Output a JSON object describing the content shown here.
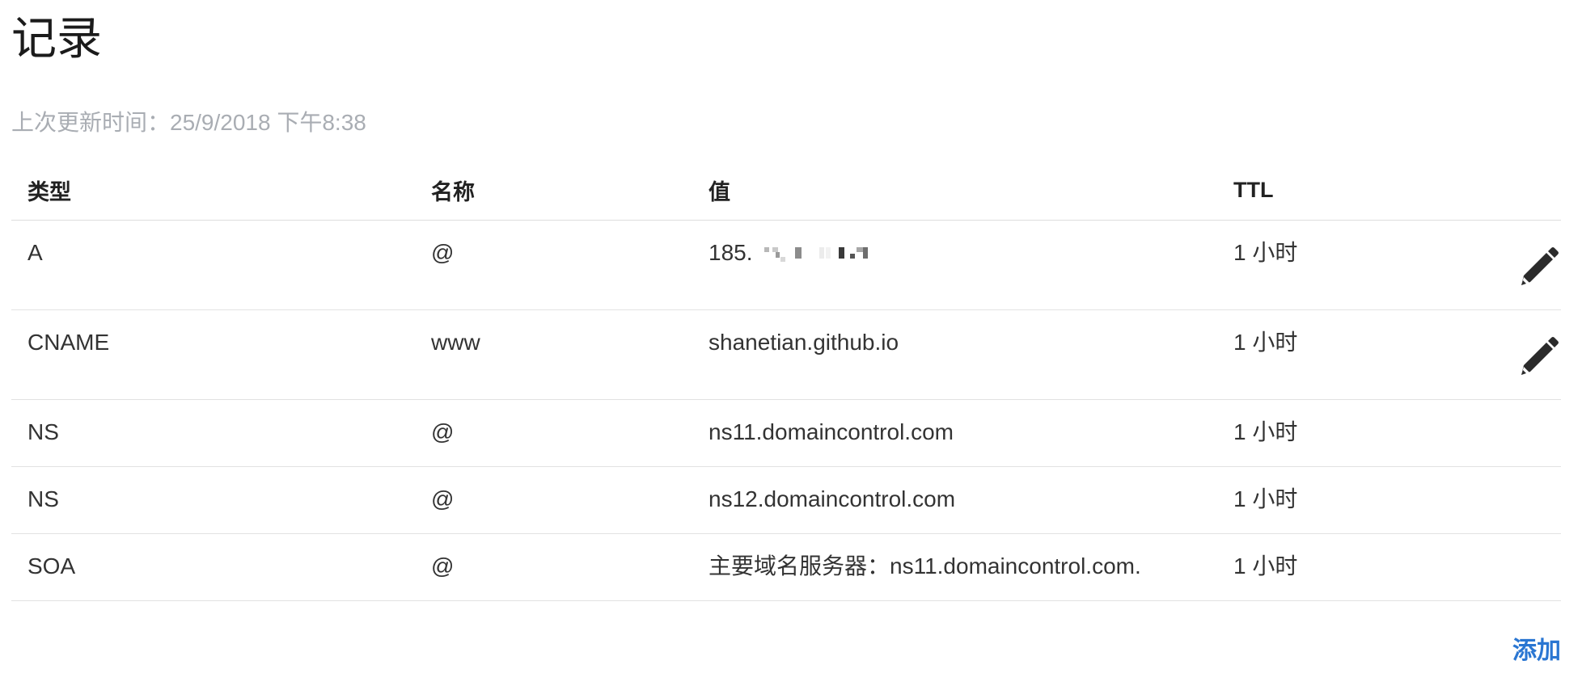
{
  "header": {
    "title": "记录",
    "last_updated": "上次更新时间：25/9/2018 下午8:38"
  },
  "table": {
    "columns": [
      "类型",
      "名称",
      "值",
      "TTL"
    ],
    "rows": [
      {
        "type": "A",
        "name": "@",
        "value": "185.",
        "ttl": "1 小时",
        "editable": true
      },
      {
        "type": "CNAME",
        "name": "www",
        "value": "shanetian.github.io",
        "ttl": "1 小时",
        "editable": true
      },
      {
        "type": "NS",
        "name": "@",
        "value": "ns11.domaincontrol.com",
        "ttl": "1 小时",
        "editable": false
      },
      {
        "type": "NS",
        "name": "@",
        "value": "ns12.domaincontrol.com",
        "ttl": "1 小时",
        "editable": false
      },
      {
        "type": "SOA",
        "name": "@",
        "value": "主要域名服务器：ns11.domaincontrol.com.",
        "ttl": "1 小时",
        "editable": false
      }
    ]
  },
  "footer": {
    "add_label": "添加"
  },
  "icons": {
    "edit": "pencil-icon"
  },
  "colors": {
    "link": "#2a76d2",
    "muted": "#a9adb3",
    "text": "#333333",
    "border": "#e2e2e2"
  }
}
